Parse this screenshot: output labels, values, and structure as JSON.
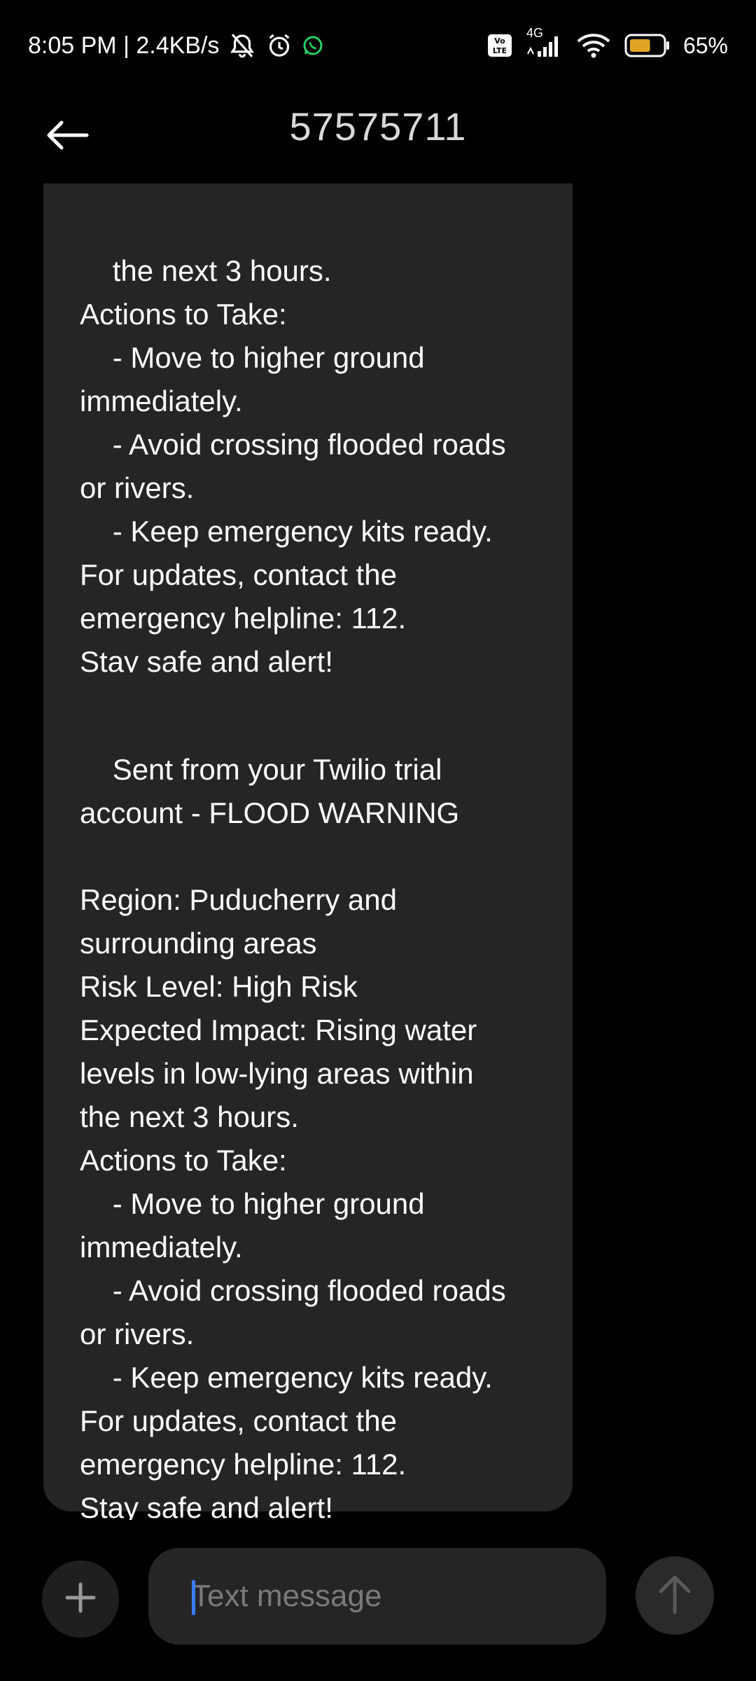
{
  "status_bar": {
    "time_speed": "8:05 PM | 2.4KB/s",
    "network_type": "4G",
    "volte_label": "Vo LTE",
    "battery_percent": "65%",
    "battery_level": 0.65,
    "battery_color": "#e0a526",
    "icons": [
      "alarm-off-icon",
      "alarm-icon",
      "whatsapp-icon",
      "volte-icon",
      "signal-icon",
      "wifi-icon",
      "battery-icon"
    ]
  },
  "app_bar": {
    "title": "57575711",
    "back_icon": "arrow-left-icon"
  },
  "messages": [
    {
      "text": "the next 3 hours.\nActions to Take:\n    - Move to higher ground\nimmediately.\n    - Avoid crossing flooded roads\nor rivers.\n    - Keep emergency kits ready.\nFor updates, contact the\nemergency helpline: 112.\nStay safe and alert!"
    },
    {
      "text": "Sent from your Twilio trial\naccount - FLOOD WARNING\n\nRegion: Puducherry and\nsurrounding areas\nRisk Level: High Risk\nExpected Impact: Rising water\nlevels in low-lying areas within\nthe next 3 hours.\nActions to Take:\n    - Move to higher ground\nimmediately.\n    - Avoid crossing flooded roads\nor rivers.\n    - Keep emergency kits ready.\nFor updates, contact the\nemergency helpline: 112.\nStay safe and alert!"
    }
  ],
  "composer": {
    "placeholder": "Text message",
    "value": "",
    "add_icon": "plus-icon",
    "send_icon": "arrow-up-icon",
    "caret_color": "#3d7bff"
  }
}
